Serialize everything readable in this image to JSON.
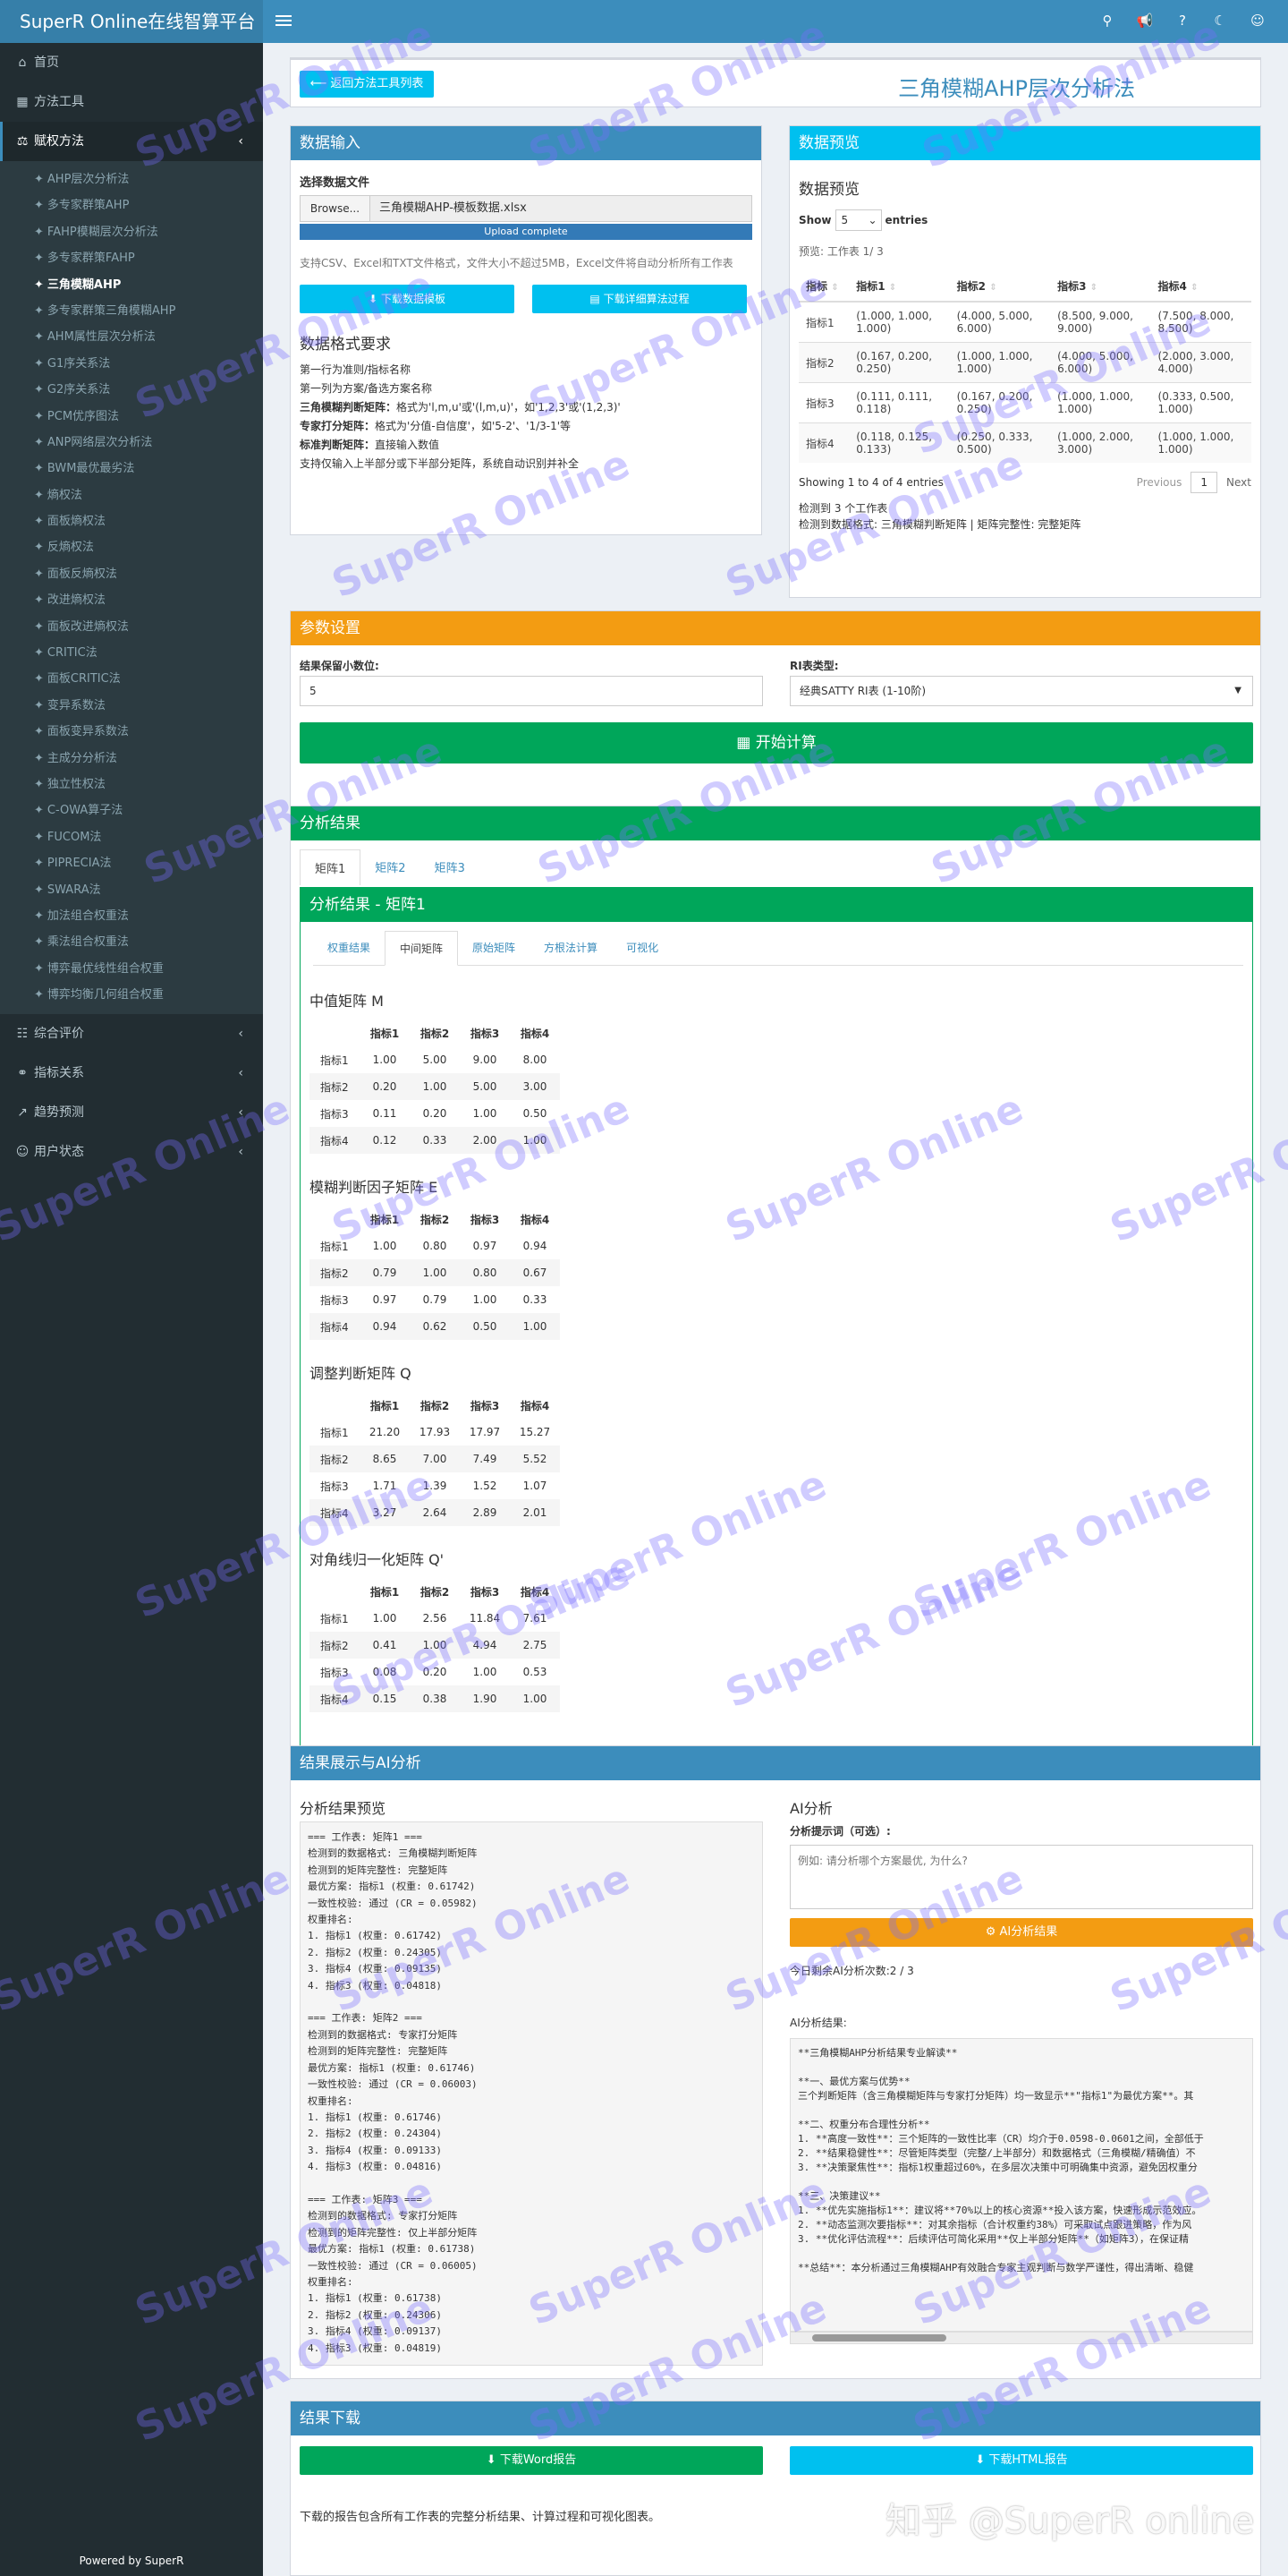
{
  "app": {
    "title": "SuperR Online在线智算平台"
  },
  "header": {
    "icons": [
      "search-icon",
      "bullhorn-icon",
      "help-icon",
      "moon-icon",
      "user-icon"
    ]
  },
  "sidebar": {
    "top_items": [
      {
        "label": "首页",
        "icon": "home-icon"
      },
      {
        "label": "方法工具",
        "icon": "table-icon"
      }
    ],
    "group": {
      "label": "赋权方法",
      "icon": "balance-icon"
    },
    "sub_items": [
      "AHP层次分析法",
      "多专家群策AHP",
      "FAHP模糊层次分析法",
      "多专家群策FAHP",
      "三角模糊AHP",
      "多专家群策三角模糊AHP",
      "AHM属性层次分析法",
      "G1序关系法",
      "G2序关系法",
      "PCM优序图法",
      "ANP网络层次分析法",
      "BWM最优最劣法",
      "熵权法",
      "面板熵权法",
      "反熵权法",
      "面板反熵权法",
      "改进熵权法",
      "面板改进熵权法",
      "CRITIC法",
      "面板CRITIC法",
      "变异系数法",
      "面板变异系数法",
      "主成分分析法",
      "独立性权法",
      "C-OWA算子法",
      "FUCOM法",
      "PIPRECIA法",
      "SWARA法",
      "加法组合权重法",
      "乘法组合权重法",
      "博弈最优线性组合权重",
      "博弈均衡几何组合权重"
    ],
    "current_index": 4,
    "bottom_items": [
      {
        "label": "综合评价",
        "icon": "eval-icon"
      },
      {
        "label": "指标关系",
        "icon": "link-icon"
      },
      {
        "label": "趋势预测",
        "icon": "chart-icon"
      },
      {
        "label": "用户状态",
        "icon": "user-icon"
      }
    ],
    "powered": "Powered by SuperR"
  },
  "page": {
    "back_button": "返回方法工具列表",
    "title": "三角模糊AHP层次分析法"
  },
  "data_input": {
    "header": "数据输入",
    "file_label": "选择数据文件",
    "browse": "Browse...",
    "filename": "三角模糊AHP-模板数据.xlsx",
    "progress": 1.0,
    "upload_status": "Upload complete",
    "support_text": "支持CSV、Excel和TXT文件格式，文件大小不超过5MB，Excel文件将自动分析所有工作表",
    "download_template": "下载数据模板",
    "download_process": "下载详细算法过程",
    "format_title": "数据格式要求",
    "format_lines": [
      {
        "bold": "",
        "text": "第一行为准则/指标名称"
      },
      {
        "bold": "",
        "text": "第一列为方案/备选方案名称"
      },
      {
        "bold": "三角模糊判断矩阵：",
        "text": "格式为'l,m,u'或'(l,m,u)'，如'1,2,3'或'(1,2,3)'"
      },
      {
        "bold": "专家打分矩阵：",
        "text": "格式为'分值-自信度'，如'5-2'、'1/3-1'等"
      },
      {
        "bold": "标准判断矩阵：",
        "text": "直接输入数值"
      },
      {
        "bold": "",
        "text": "支持仅输入上半部分或下半部分矩阵，系统自动识别并补全"
      }
    ]
  },
  "preview": {
    "header": "数据预览",
    "title": "数据预览",
    "show": "Show",
    "show_value": "5",
    "entries": "entries",
    "sheet_label": "预览: 工作表 1/ 3",
    "columns": [
      "指标",
      "指标1",
      "指标2",
      "指标3",
      "指标4"
    ],
    "rows": [
      [
        "指标1",
        "(1.000, 1.000, 1.000)",
        "(4.000, 5.000, 6.000)",
        "(8.500, 9.000, 9.000)",
        "(7.500, 8.000, 8.500)"
      ],
      [
        "指标2",
        "(0.167, 0.200, 0.250)",
        "(1.000, 1.000, 1.000)",
        "(4.000, 5.000, 6.000)",
        "(2.000, 3.000, 4.000)"
      ],
      [
        "指标3",
        "(0.111, 0.111, 0.118)",
        "(0.167, 0.200, 0.250)",
        "(1.000, 1.000, 1.000)",
        "(0.333, 0.500, 1.000)"
      ],
      [
        "指标4",
        "(0.118, 0.125, 0.133)",
        "(0.250, 0.333, 0.500)",
        "(1.000, 2.000, 3.000)",
        "(1.000, 1.000, 1.000)"
      ]
    ],
    "showing": "Showing 1 to 4 of 4 entries",
    "previous": "Previous",
    "page": "1",
    "next": "Next",
    "detected_sheets": "检测到 3 个工作表",
    "detected_format": "检测到数据格式: 三角模糊判断矩阵 | 矩阵完整性: 完整矩阵"
  },
  "params": {
    "header": "参数设置",
    "decimal_label": "结果保留小数位:",
    "decimal_value": "5",
    "ri_label": "RI表类型:",
    "ri_value": "经典SATTY RI表 (1-10阶)",
    "calc_button": "开始计算"
  },
  "results": {
    "header": "分析结果",
    "tabs": [
      "矩阵1",
      "矩阵2",
      "矩阵3"
    ],
    "inner_header": "分析结果 - 矩阵1",
    "sub_tabs": [
      "权重结果",
      "中间矩阵",
      "原始矩阵",
      "方根法计算",
      "可视化"
    ],
    "col_headers": [
      "指标1",
      "指标2",
      "指标3",
      "指标4"
    ],
    "matrices": [
      {
        "title": "中值矩阵 M",
        "rows": [
          [
            "指标1",
            "1.00",
            "5.00",
            "9.00",
            "8.00"
          ],
          [
            "指标2",
            "0.20",
            "1.00",
            "5.00",
            "3.00"
          ],
          [
            "指标3",
            "0.11",
            "0.20",
            "1.00",
            "0.50"
          ],
          [
            "指标4",
            "0.12",
            "0.33",
            "2.00",
            "1.00"
          ]
        ]
      },
      {
        "title": "模糊判断因子矩阵 E",
        "rows": [
          [
            "指标1",
            "1.00",
            "0.80",
            "0.97",
            "0.94"
          ],
          [
            "指标2",
            "0.79",
            "1.00",
            "0.80",
            "0.67"
          ],
          [
            "指标3",
            "0.97",
            "0.79",
            "1.00",
            "0.33"
          ],
          [
            "指标4",
            "0.94",
            "0.62",
            "0.50",
            "1.00"
          ]
        ]
      },
      {
        "title": "调整判断矩阵 Q",
        "rows": [
          [
            "指标1",
            "21.20",
            "17.93",
            "17.97",
            "15.27"
          ],
          [
            "指标2",
            "8.65",
            "7.00",
            "7.49",
            "5.52"
          ],
          [
            "指标3",
            "1.71",
            "1.39",
            "1.52",
            "1.07"
          ],
          [
            "指标4",
            "3.27",
            "2.64",
            "2.89",
            "2.01"
          ]
        ]
      },
      {
        "title": "对角线归一化矩阵 Q'",
        "rows": [
          [
            "指标1",
            "1.00",
            "2.56",
            "11.84",
            "7.61"
          ],
          [
            "指标2",
            "0.41",
            "1.00",
            "4.94",
            "2.75"
          ],
          [
            "指标3",
            "0.08",
            "0.20",
            "1.00",
            "0.53"
          ],
          [
            "指标4",
            "0.15",
            "0.38",
            "1.90",
            "1.00"
          ]
        ]
      }
    ]
  },
  "ai": {
    "header": "结果展示与AI分析",
    "preview_title": "分析结果预览",
    "preview_text": "=== 工作表: 矩阵1 ===\n检测到的数据格式: 三角模糊判断矩阵\n检测到的矩阵完整性: 完整矩阵\n最优方案: 指标1 (权重: 0.61742)\n一致性校验: 通过 (CR = 0.05982)\n权重排名:\n1. 指标1 (权重: 0.61742)\n2. 指标2 (权重: 0.24305)\n3. 指标4 (权重: 0.09135)\n4. 指标3 (权重: 0.04818)\n\n=== 工作表: 矩阵2 ===\n检测到的数据格式: 专家打分矩阵\n检测到的矩阵完整性: 完整矩阵\n最优方案: 指标1 (权重: 0.61746)\n一致性校验: 通过 (CR = 0.06003)\n权重排名:\n1. 指标1 (权重: 0.61746)\n2. 指标2 (权重: 0.24304)\n3. 指标4 (权重: 0.09133)\n4. 指标3 (权重: 0.04816)\n\n=== 工作表: 矩阵3 ===\n检测到的数据格式: 专家打分矩阵\n检测到的矩阵完整性: 仅上半部分矩阵\n最优方案: 指标1 (权重: 0.61738)\n一致性校验: 通过 (CR = 0.06005)\n权重排名:\n1. 指标1 (权重: 0.61738)\n2. 指标2 (权重: 0.24306)\n3. 指标4 (权重: 0.09137)\n4. 指标3 (权重: 0.04819)",
    "ai_title": "AI分析",
    "prompt_label": "分析提示词（可选）:",
    "prompt_placeholder": "例如: 请分析哪个方案最优, 为什么?",
    "ai_button": "AI分析结果",
    "remaining": "今日剩余AI分析次数:2 / 3",
    "result_label": "AI分析结果:",
    "result_text": "**三角模糊AHP分析结果专业解读**\n\n**一、最优方案与优势**\n三个判断矩阵（含三角模糊矩阵与专家打分矩阵）均一致显示**\"指标1\"为最优方案**。其\n\n**二、权重分布合理性分析**\n1. **高度一致性**：三个矩阵的一致性比率（CR）均介于0.0598-0.0601之间，全部低于\n2. **结果稳健性**：尽管矩阵类型（完整/上半部分）和数据格式（三角模糊/精确值）不\n3. **决策聚焦性**：指标1权重超过60%，在多层次决策中可明确集中资源，避免因权重分\n\n**三、决策建议**\n1. **优先实施指标1**：建议将**70%以上的核心资源**投入该方案，快速形成示范效应。\n2. **动态监测次要指标**：对其余指标（合计权重约38%）可采取试点跟进策略，作为风\n3. **优化评估流程**：后续评估可简化采用**仅上半部分矩阵**（如矩阵3），在保证精\n\n**总结**：本分析通过三角模糊AHP有效融合专家主观判断与数学严谨性，得出清晰、稳健"
  },
  "download": {
    "header": "结果下载",
    "word_button": "下载Word报告",
    "html_button": "下载HTML报告",
    "note": "下载的报告包含所有工作表的完整分析结果、计算过程和可视化图表。"
  },
  "watermarks": {
    "text": "SuperR Online",
    "corner": "知乎 @SuperR online"
  },
  "colors": {
    "primary": "#3c8dbc",
    "aqua": "#00c0ef",
    "orange": "#f39c12",
    "green": "#00a65a",
    "sidebar": "#222d32"
  }
}
